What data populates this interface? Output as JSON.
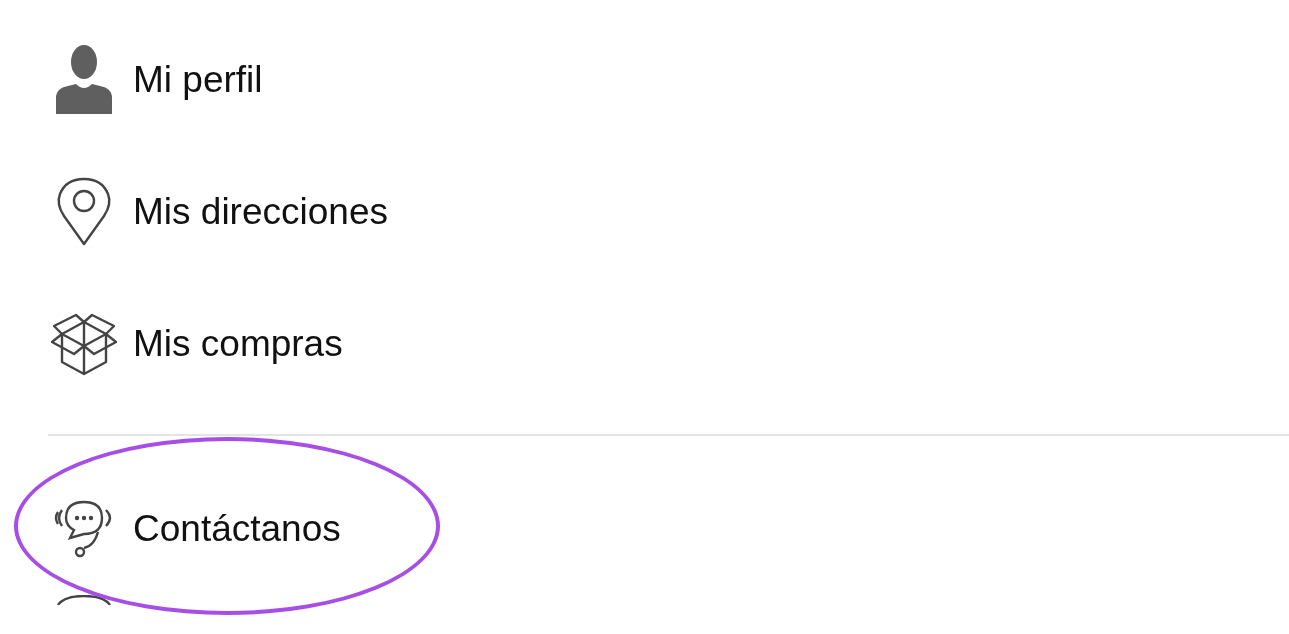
{
  "menu_groups": [
    {
      "items": [
        {
          "kind": "entry",
          "label": "Mi perfil",
          "highlighted": false
        },
        {
          "kind": "entry",
          "label": "Mis direcciones",
          "highlighted": false
        },
        {
          "kind": "entry",
          "label": "Mis compras",
          "highlighted": false
        }
      ]
    },
    {
      "items": [
        {
          "kind": "entry",
          "label": "Contáctanos",
          "highlighted": true
        },
        {
          "kind": "partial"
        }
      ]
    }
  ]
}
